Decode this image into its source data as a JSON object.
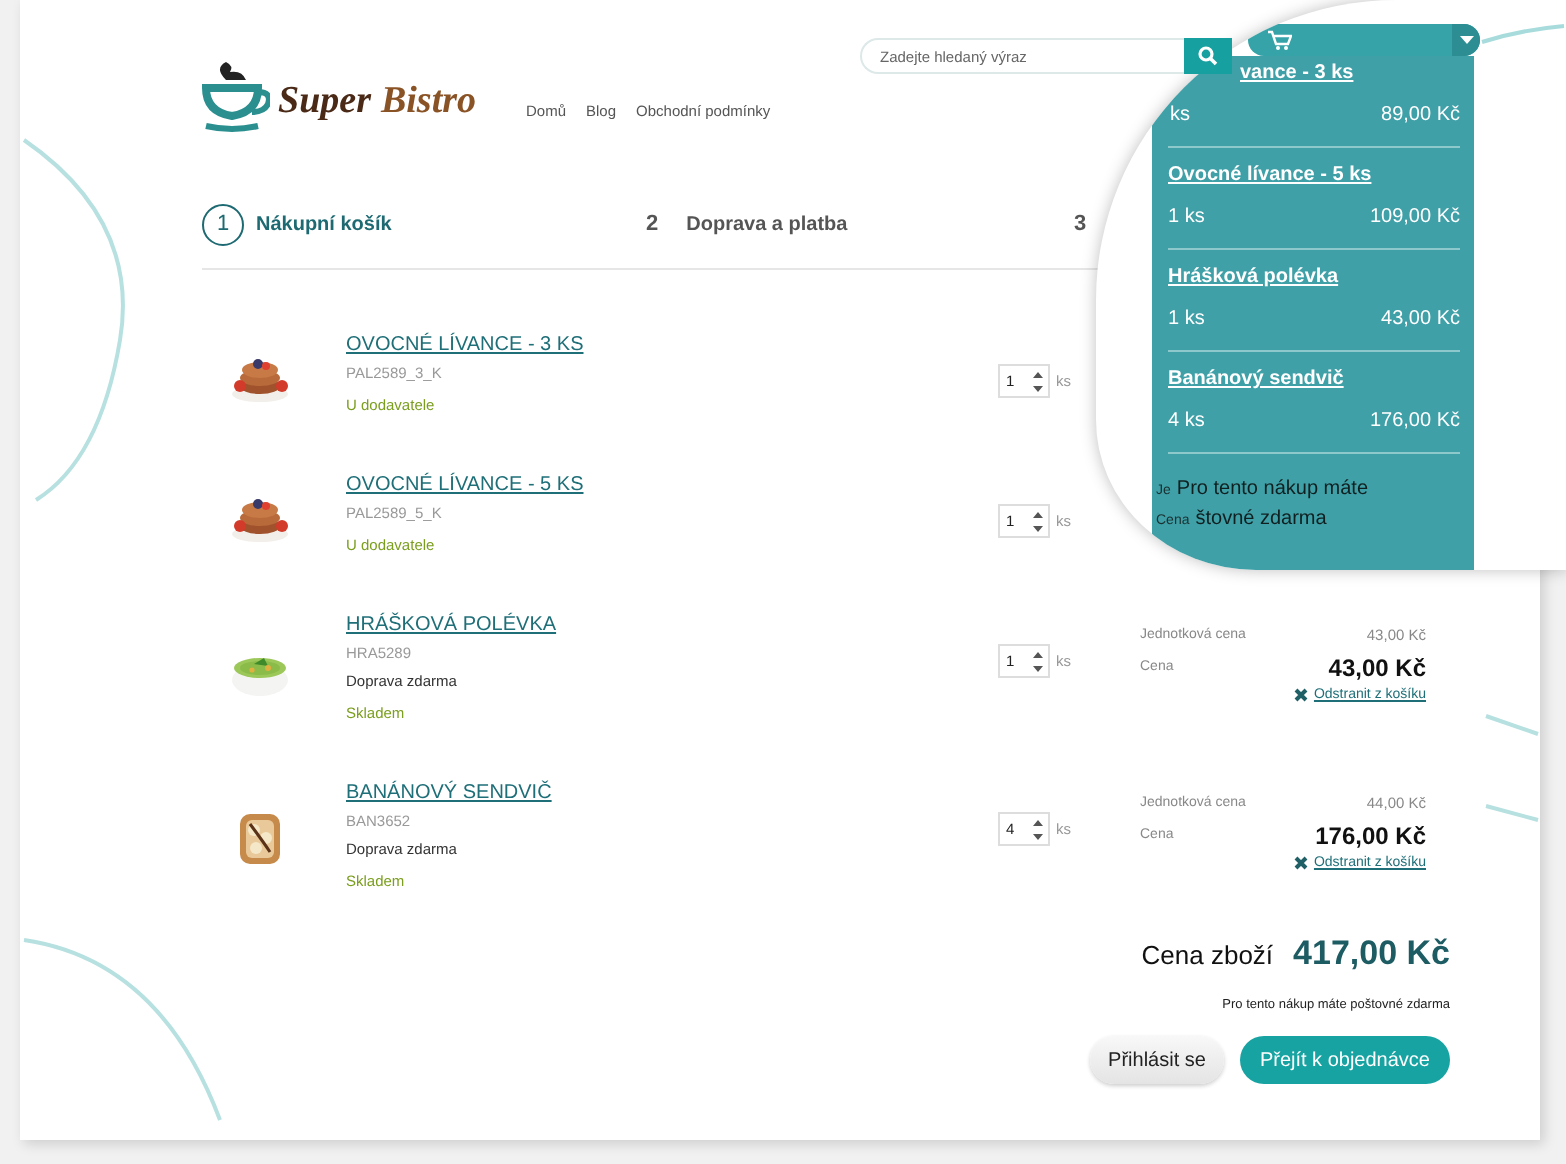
{
  "header": {
    "logo": {
      "first": "Super",
      "second": "Bistro"
    },
    "nav": [
      {
        "label": "Domů"
      },
      {
        "label": "Blog"
      },
      {
        "label": "Obchodní podmínky"
      }
    ],
    "search": {
      "placeholder": "Zadejte hledaný výraz"
    }
  },
  "steps": [
    {
      "number": "1",
      "label": "Nákupní košík",
      "selected": true
    },
    {
      "number": "2",
      "label": "Doprava a platba",
      "selected": false
    },
    {
      "number": "3",
      "selected": false
    }
  ],
  "items": [
    {
      "name": "OVOCNÉ LÍVANCE - 3 KS",
      "code": "PAL2589_3_K",
      "status": "U dodavatele",
      "quantity": "1",
      "unit": "ks"
    },
    {
      "name": "OVOCNÉ LÍVANCE - 5 KS",
      "code": "PAL2589_5_K",
      "status": "U dodavatele",
      "quantity": "1",
      "unit": "ks"
    },
    {
      "name": "HRÁŠKOVÁ POLÉVKA",
      "code": "HRA5289",
      "note": "Doprava zdarma",
      "status": "Skladem",
      "quantity": "1",
      "unit": "ks",
      "price": {
        "unit_label": "Jednotková cena",
        "unit_price": "43,00 Kč",
        "total_label": "Cena",
        "total": "43,00 Kč",
        "remove": "Odstranit z košíku"
      }
    },
    {
      "name": "BANÁNOVÝ SENDVIČ",
      "code": "BAN3652",
      "note": "Doprava zdarma",
      "status": "Skladem",
      "quantity": "4",
      "unit": "ks",
      "price": {
        "unit_label": "Jednotková cena",
        "unit_price": "44,00 Kč",
        "total_label": "Cena",
        "total": "176,00 Kč",
        "remove": "Odstranit z košíku"
      }
    }
  ],
  "summary": {
    "label": "Cena zboží",
    "total": "417,00 Kč",
    "note": "Pro tento nákup máte poštovné zdarma"
  },
  "buttons": [
    {
      "label": "Přihlásit se",
      "kind": "secondary"
    },
    {
      "label": "Přejít k objednávce",
      "kind": "primary"
    }
  ],
  "magnifier": {
    "cart_items": [
      {
        "name": "vance - 3 ks",
        "quantity": "ks",
        "price": "89,00 Kč"
      },
      {
        "name": "Ovocné lívance - 5 ks",
        "quantity": "1 ks",
        "price": "109,00 Kč"
      },
      {
        "name": "Hrášková polévka",
        "quantity": "1 ks",
        "price": "43,00 Kč"
      },
      {
        "name": "Banánový sendvič",
        "quantity": "4 ks",
        "price": "176,00 Kč"
      }
    ],
    "note_lines": [
      {
        "peek": "Je",
        "text": "Pro tento nákup máte"
      },
      {
        "peek": "Cena",
        "text": "štovné zdarma"
      }
    ]
  }
}
